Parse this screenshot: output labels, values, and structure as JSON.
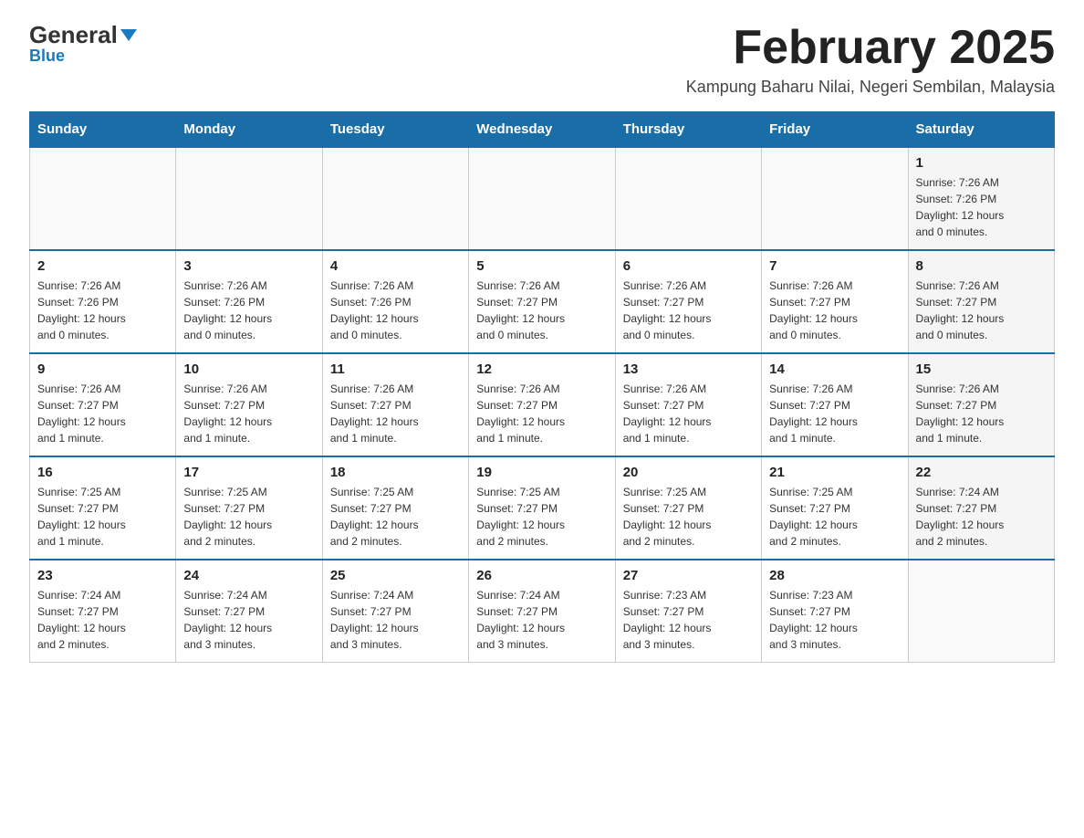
{
  "logo": {
    "text_general": "General",
    "text_blue": "Blue"
  },
  "header": {
    "month_title": "February 2025",
    "subtitle": "Kampung Baharu Nilai, Negeri Sembilan, Malaysia"
  },
  "weekdays": [
    "Sunday",
    "Monday",
    "Tuesday",
    "Wednesday",
    "Thursday",
    "Friday",
    "Saturday"
  ],
  "weeks": [
    [
      {
        "day": "",
        "info": ""
      },
      {
        "day": "",
        "info": ""
      },
      {
        "day": "",
        "info": ""
      },
      {
        "day": "",
        "info": ""
      },
      {
        "day": "",
        "info": ""
      },
      {
        "day": "",
        "info": ""
      },
      {
        "day": "1",
        "info": "Sunrise: 7:26 AM\nSunset: 7:26 PM\nDaylight: 12 hours\nand 0 minutes."
      }
    ],
    [
      {
        "day": "2",
        "info": "Sunrise: 7:26 AM\nSunset: 7:26 PM\nDaylight: 12 hours\nand 0 minutes."
      },
      {
        "day": "3",
        "info": "Sunrise: 7:26 AM\nSunset: 7:26 PM\nDaylight: 12 hours\nand 0 minutes."
      },
      {
        "day": "4",
        "info": "Sunrise: 7:26 AM\nSunset: 7:26 PM\nDaylight: 12 hours\nand 0 minutes."
      },
      {
        "day": "5",
        "info": "Sunrise: 7:26 AM\nSunset: 7:27 PM\nDaylight: 12 hours\nand 0 minutes."
      },
      {
        "day": "6",
        "info": "Sunrise: 7:26 AM\nSunset: 7:27 PM\nDaylight: 12 hours\nand 0 minutes."
      },
      {
        "day": "7",
        "info": "Sunrise: 7:26 AM\nSunset: 7:27 PM\nDaylight: 12 hours\nand 0 minutes."
      },
      {
        "day": "8",
        "info": "Sunrise: 7:26 AM\nSunset: 7:27 PM\nDaylight: 12 hours\nand 0 minutes."
      }
    ],
    [
      {
        "day": "9",
        "info": "Sunrise: 7:26 AM\nSunset: 7:27 PM\nDaylight: 12 hours\nand 1 minute."
      },
      {
        "day": "10",
        "info": "Sunrise: 7:26 AM\nSunset: 7:27 PM\nDaylight: 12 hours\nand 1 minute."
      },
      {
        "day": "11",
        "info": "Sunrise: 7:26 AM\nSunset: 7:27 PM\nDaylight: 12 hours\nand 1 minute."
      },
      {
        "day": "12",
        "info": "Sunrise: 7:26 AM\nSunset: 7:27 PM\nDaylight: 12 hours\nand 1 minute."
      },
      {
        "day": "13",
        "info": "Sunrise: 7:26 AM\nSunset: 7:27 PM\nDaylight: 12 hours\nand 1 minute."
      },
      {
        "day": "14",
        "info": "Sunrise: 7:26 AM\nSunset: 7:27 PM\nDaylight: 12 hours\nand 1 minute."
      },
      {
        "day": "15",
        "info": "Sunrise: 7:26 AM\nSunset: 7:27 PM\nDaylight: 12 hours\nand 1 minute."
      }
    ],
    [
      {
        "day": "16",
        "info": "Sunrise: 7:25 AM\nSunset: 7:27 PM\nDaylight: 12 hours\nand 1 minute."
      },
      {
        "day": "17",
        "info": "Sunrise: 7:25 AM\nSunset: 7:27 PM\nDaylight: 12 hours\nand 2 minutes."
      },
      {
        "day": "18",
        "info": "Sunrise: 7:25 AM\nSunset: 7:27 PM\nDaylight: 12 hours\nand 2 minutes."
      },
      {
        "day": "19",
        "info": "Sunrise: 7:25 AM\nSunset: 7:27 PM\nDaylight: 12 hours\nand 2 minutes."
      },
      {
        "day": "20",
        "info": "Sunrise: 7:25 AM\nSunset: 7:27 PM\nDaylight: 12 hours\nand 2 minutes."
      },
      {
        "day": "21",
        "info": "Sunrise: 7:25 AM\nSunset: 7:27 PM\nDaylight: 12 hours\nand 2 minutes."
      },
      {
        "day": "22",
        "info": "Sunrise: 7:24 AM\nSunset: 7:27 PM\nDaylight: 12 hours\nand 2 minutes."
      }
    ],
    [
      {
        "day": "23",
        "info": "Sunrise: 7:24 AM\nSunset: 7:27 PM\nDaylight: 12 hours\nand 2 minutes."
      },
      {
        "day": "24",
        "info": "Sunrise: 7:24 AM\nSunset: 7:27 PM\nDaylight: 12 hours\nand 3 minutes."
      },
      {
        "day": "25",
        "info": "Sunrise: 7:24 AM\nSunset: 7:27 PM\nDaylight: 12 hours\nand 3 minutes."
      },
      {
        "day": "26",
        "info": "Sunrise: 7:24 AM\nSunset: 7:27 PM\nDaylight: 12 hours\nand 3 minutes."
      },
      {
        "day": "27",
        "info": "Sunrise: 7:23 AM\nSunset: 7:27 PM\nDaylight: 12 hours\nand 3 minutes."
      },
      {
        "day": "28",
        "info": "Sunrise: 7:23 AM\nSunset: 7:27 PM\nDaylight: 12 hours\nand 3 minutes."
      },
      {
        "day": "",
        "info": ""
      }
    ]
  ]
}
